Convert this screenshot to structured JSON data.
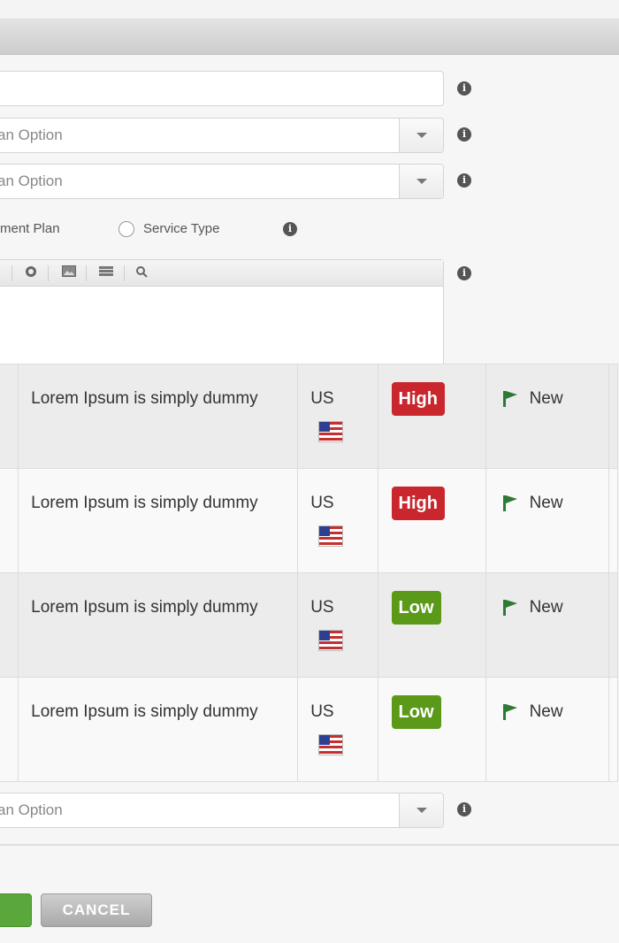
{
  "form": {
    "select1_text": "an Option",
    "select2_text": "an Option",
    "select3_text": "an Option",
    "radio1_label": "ment Plan",
    "radio2_label": "Service Type",
    "info_glyph": "i"
  },
  "table": {
    "rows": [
      {
        "description": "Lorem Ipsum is simply dummy",
        "country": "US",
        "priority": "High",
        "status": "New"
      },
      {
        "description": "Lorem Ipsum is simply dummy",
        "country": "US",
        "priority": "High",
        "status": "New"
      },
      {
        "description": "Lorem Ipsum is simply dummy",
        "country": "US",
        "priority": "Low",
        "status": "New"
      },
      {
        "description": "Lorem Ipsum is simply dummy",
        "country": "US",
        "priority": "Low",
        "status": "New"
      }
    ]
  },
  "buttons": {
    "cancel_label": "CANCEL"
  },
  "colors": {
    "high": "#c9262d",
    "low": "#5a9a18",
    "flag_green": "#2e7a35"
  },
  "icons": [
    "info-icon",
    "chevron-down-icon",
    "link-icon",
    "image-icon",
    "list-icon",
    "search-icon",
    "flag-icon",
    "us-flag-icon"
  ]
}
